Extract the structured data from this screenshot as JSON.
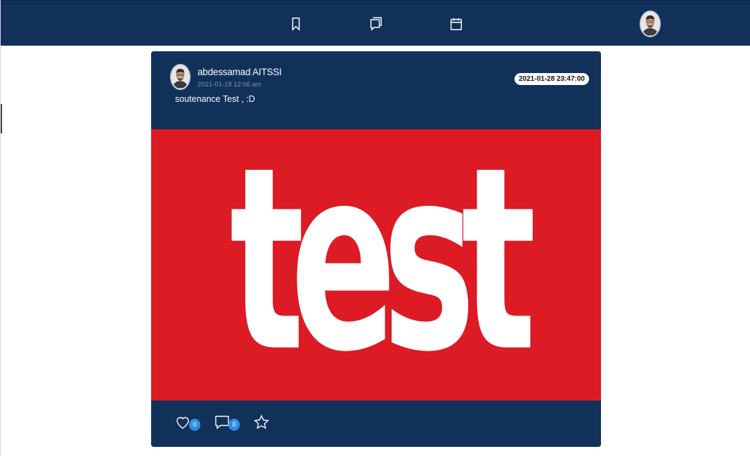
{
  "navbar": {
    "icons": [
      "bookmark-icon",
      "chat-icon",
      "calendar-icon"
    ],
    "user_avatar": "user-avatar"
  },
  "post": {
    "author_name": "abdessamad AITSSI",
    "posted_at": "2021-01-18 12:06 am",
    "text": "soutenance Test , :D",
    "deadline": "2021-01-28 23:47:00",
    "image_text": "test",
    "image_bg_color": "#dc1b25",
    "likes_count": "0",
    "comments_count": "0"
  },
  "colors": {
    "navy": "#11315a",
    "badge_blue": "#2f8fe6",
    "white": "#ffffff"
  }
}
